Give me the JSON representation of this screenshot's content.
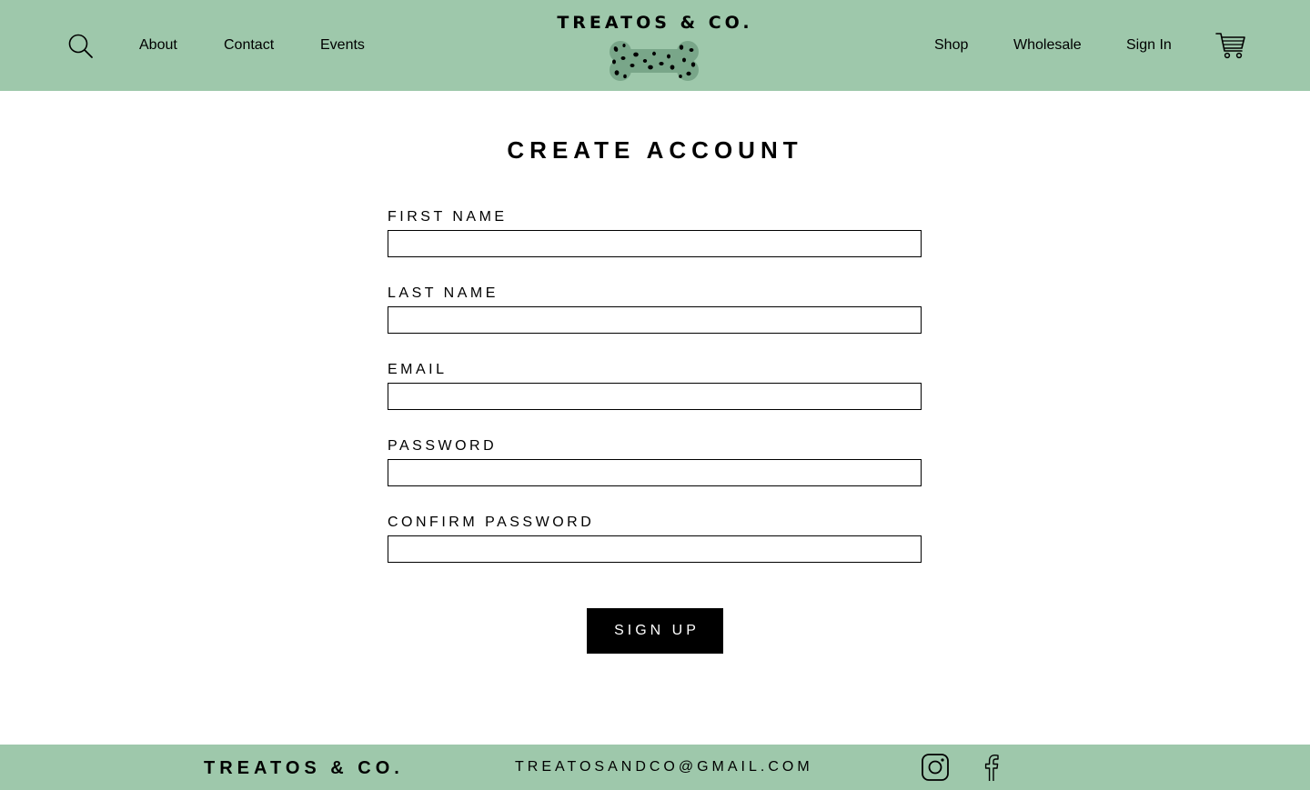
{
  "header": {
    "brand": "TREATOS & CO.",
    "nav_left": [
      "About",
      "Contact",
      "Events"
    ],
    "nav_right": [
      "Shop",
      "Wholesale",
      "Sign In"
    ],
    "icons": {
      "search": "search-icon",
      "cart": "cart-icon",
      "logo": "dog-bone-logo"
    },
    "colors": {
      "bar": "#9ec8ab",
      "bone": "#79a689",
      "spots": "#000000"
    }
  },
  "form": {
    "title": "CREATE ACCOUNT",
    "fields": [
      {
        "label": "FIRST NAME",
        "value": ""
      },
      {
        "label": "LAST NAME",
        "value": ""
      },
      {
        "label": "EMAIL",
        "value": ""
      },
      {
        "label": "PASSWORD",
        "value": ""
      },
      {
        "label": "CONFIRM PASSWORD",
        "value": ""
      }
    ],
    "submit_label": "SIGN UP"
  },
  "footer": {
    "brand": "TREATOS & CO.",
    "email": "TREATOSANDCO@GMAIL.COM",
    "social_icons": [
      "instagram-icon",
      "facebook-icon"
    ],
    "color": "#9ec8ab"
  }
}
